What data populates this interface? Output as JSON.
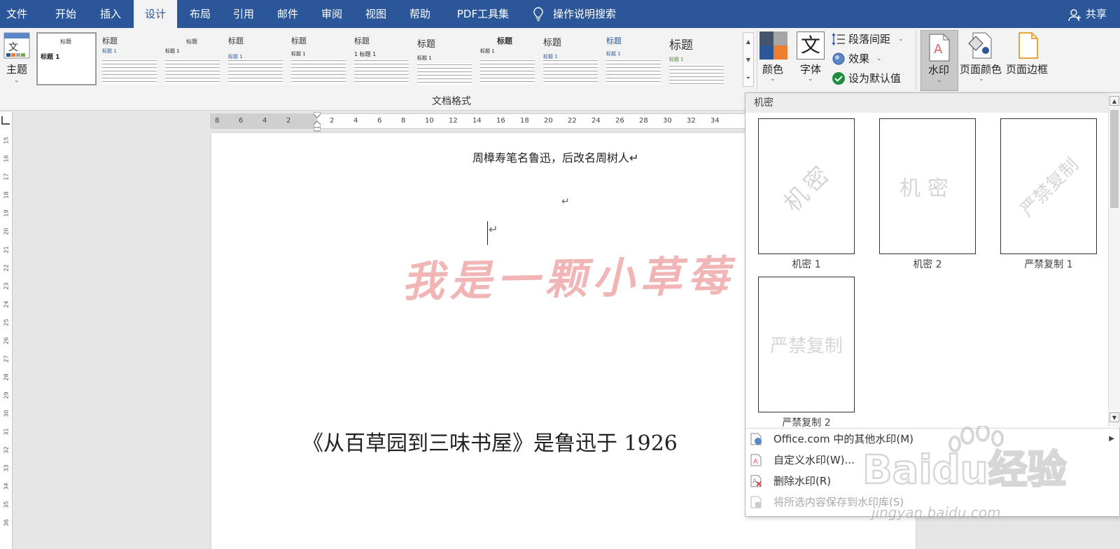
{
  "menu": {
    "tabs": [
      "文件",
      "开始",
      "插入",
      "设计",
      "布局",
      "引用",
      "邮件",
      "审阅",
      "视图",
      "帮助",
      "PDF工具集"
    ],
    "active": "设计",
    "tell_me": "操作说明搜索",
    "share": "共享"
  },
  "ribbon": {
    "theme_label": "主题",
    "gallery_thumbs": [
      {
        "title": "标题",
        "sub": "标题 1"
      },
      {
        "title": "标题",
        "sub": "标题 1"
      },
      {
        "title": "标题",
        "sub": "标题 1"
      },
      {
        "title": "标题",
        "sub": "标题 1"
      },
      {
        "title": "标题",
        "sub": "标题 1"
      },
      {
        "title": "标题",
        "sub": "1 标题 1"
      },
      {
        "title": "标题",
        "sub": "标题 1"
      },
      {
        "title": "标题",
        "sub": "标题 1"
      },
      {
        "title": "标题",
        "sub": "标题 1"
      },
      {
        "title": "标题",
        "sub": "标题 1"
      },
      {
        "title": "标题",
        "sub": "标题 1"
      }
    ],
    "group_label": "文档格式",
    "colors_label": "颜色",
    "fonts_label": "字体",
    "fonts_glyph": "文",
    "paragraph_spacing": "段落间距",
    "effects": "效果",
    "set_default": "设为默认值",
    "watermark": "水印",
    "page_color": "页面颜色",
    "page_border": "页面边框"
  },
  "ruler": {
    "h_numbers": [
      "8",
      "6",
      "4",
      "2",
      "2",
      "4",
      "6",
      "8",
      "10",
      "12",
      "14",
      "16",
      "18",
      "20",
      "22",
      "24",
      "26",
      "28",
      "30",
      "32",
      "34"
    ],
    "v_numbers": [
      "15",
      "16",
      "17",
      "18",
      "19",
      "20",
      "21",
      "22",
      "23",
      "24",
      "25",
      "26",
      "27",
      "28",
      "29",
      "30",
      "31",
      "32",
      "33",
      "34",
      "35",
      "36"
    ]
  },
  "document": {
    "line1": "周樟寿笔名鲁迅，后改名周树人↵",
    "para_mark": "↵",
    "watermark_text": "我是一颗小草莓",
    "line2": "《从百草园到三味书屋》是鲁迅于 1926"
  },
  "dropdown": {
    "header": "机密",
    "items": [
      {
        "text": "机密",
        "caption": "机密 1"
      },
      {
        "text": "机密",
        "caption": "机密 2"
      },
      {
        "text": "严禁复制",
        "caption": "严禁复制 1"
      },
      {
        "text": "严禁复制",
        "caption": "严禁复制 2"
      }
    ],
    "menu": [
      "Office.com 中的其他水印(M)",
      "自定义水印(W)...",
      "删除水印(R)",
      "将所选内容保存到水印库(S)"
    ]
  },
  "overlay": {
    "logo_text": "Baidu经验",
    "url": "jingyan.baidu.com"
  },
  "colors": {
    "accent": "#2b579a",
    "watermark_red": "#e87878",
    "check_green": "#1e8e3e"
  }
}
